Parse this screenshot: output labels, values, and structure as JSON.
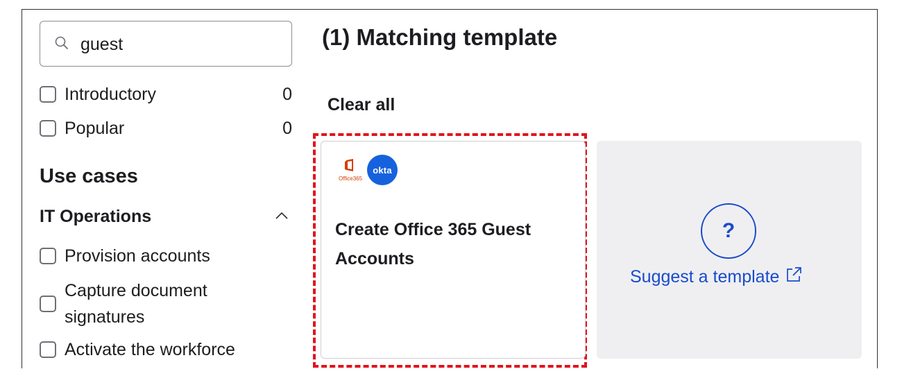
{
  "sidebar": {
    "search": {
      "value": "guest",
      "icon": "search-icon"
    },
    "filters": [
      {
        "label": "Introductory",
        "count": "0"
      },
      {
        "label": "Popular",
        "count": "0"
      }
    ],
    "use_cases_heading": "Use cases",
    "group": {
      "label": "IT Operations",
      "expanded": true,
      "icon": "chevron-up-icon",
      "items": [
        {
          "label": "Provision accounts"
        },
        {
          "label": "Capture document signatures"
        },
        {
          "label": "Activate the workforce"
        }
      ]
    }
  },
  "main": {
    "title": "(1) Matching template",
    "clear_all": "Clear all",
    "template_card": {
      "logos": [
        "Office 365",
        "okta"
      ],
      "office_logo_text": "Office365",
      "okta_logo_text": "okta",
      "title": "Create Office 365 Guest Accounts"
    },
    "suggest_card": {
      "symbol": "?",
      "link_label": "Suggest a template",
      "icon": "external-link-icon"
    }
  },
  "colors": {
    "highlight": "#e0141e",
    "link": "#1a4bc9",
    "okta_brand": "#1662dd",
    "office_brand": "#d83b01",
    "suggest_bg": "#efeff2"
  }
}
